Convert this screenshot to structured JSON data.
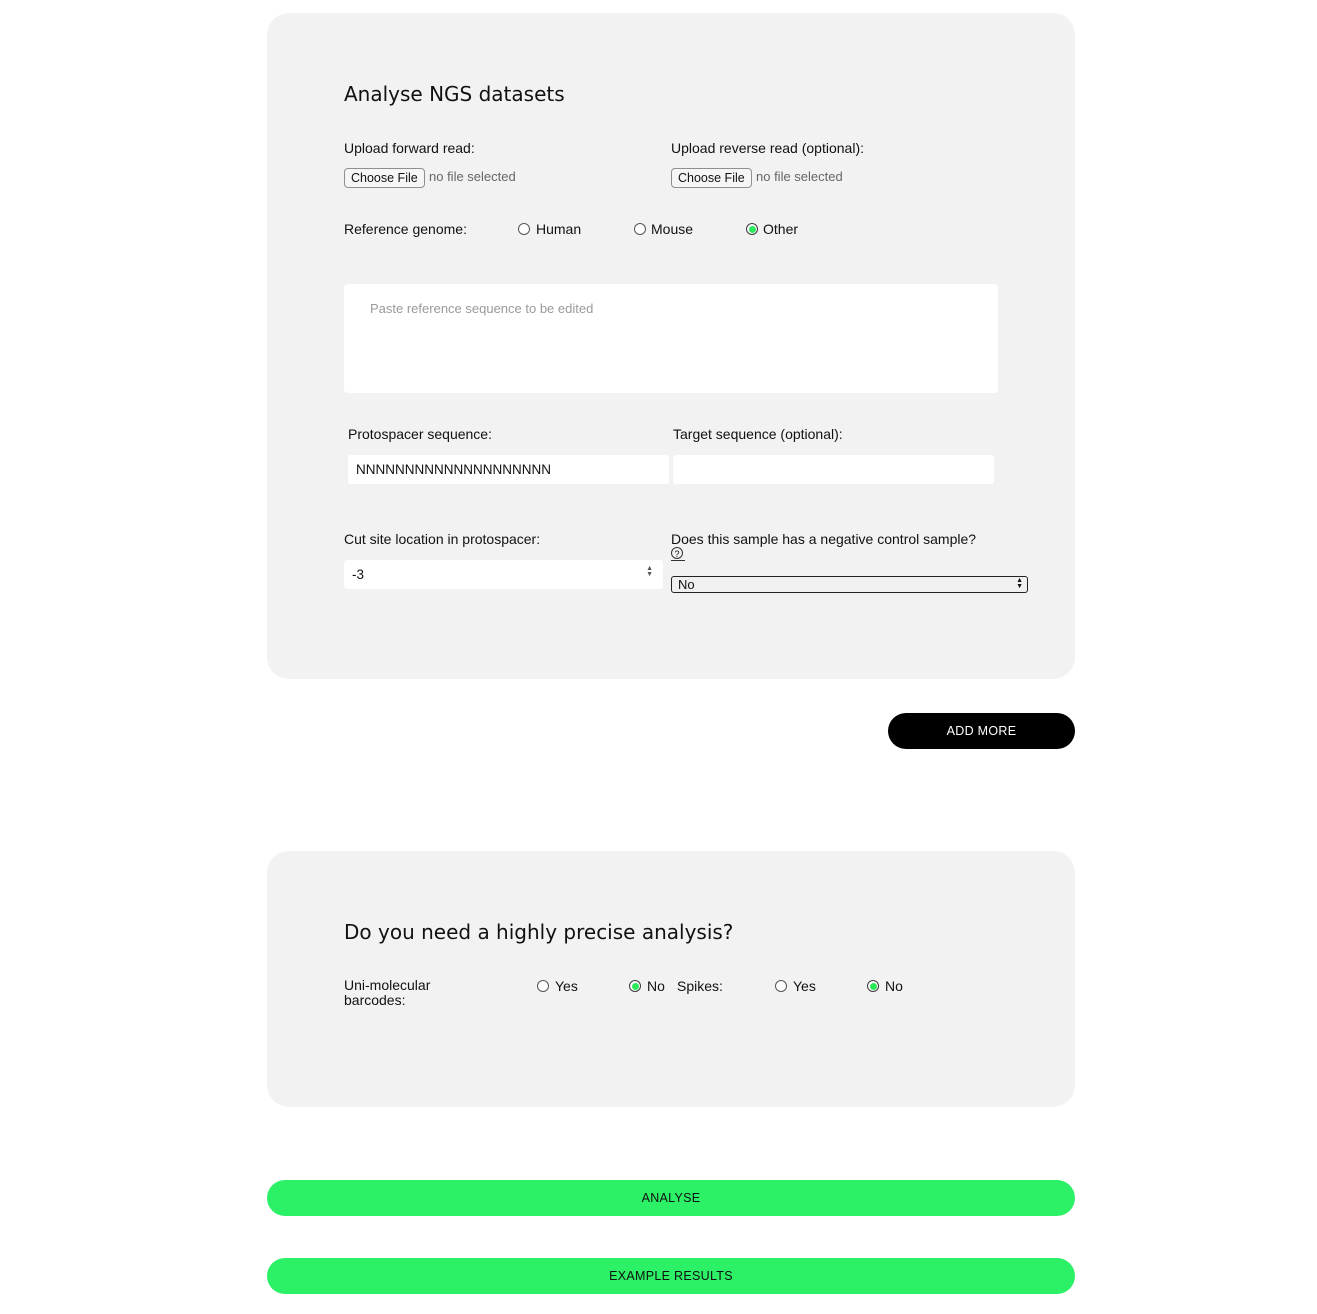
{
  "ngs": {
    "title": "Analyse NGS datasets",
    "forward_label": "Upload forward read:",
    "reverse_label": "Upload reverse read (optional):",
    "choose_file": "Choose File",
    "no_file": "no file selected",
    "reference_label": "Reference genome:",
    "genome_options": [
      "Human",
      "Mouse",
      "Other"
    ],
    "genome_selected": "Other",
    "reference_placeholder": "Paste reference sequence to be edited",
    "protospacer_label": "Protospacer sequence:",
    "protospacer_value": "NNNNNNNNNNNNNNNNNNNN",
    "target_label": "Target sequence (optional):",
    "target_value": "",
    "cut_site_label": "Cut site location in protospacer:",
    "cut_site_value": "-3",
    "negative_control_label": "Does this sample has a negative control sample?",
    "help_glyph": "?",
    "negative_control_value": "No"
  },
  "add_more_label": "ADD MORE",
  "precision": {
    "title": "Do you need a highly precise analysis?",
    "umi_label": "Uni-molecular barcodes:",
    "umi_options": [
      "Yes",
      "No"
    ],
    "umi_selected": "No",
    "spikes_label": "Spikes:",
    "spikes_options": [
      "Yes",
      "No"
    ],
    "spikes_selected": "No"
  },
  "analyse_label": "ANALYSE",
  "example_label": "EXAMPLE RESULTS",
  "colors": {
    "accent_green": "#2cf066",
    "card_bg": "#f2f2f2",
    "dark_button": "#000000"
  }
}
